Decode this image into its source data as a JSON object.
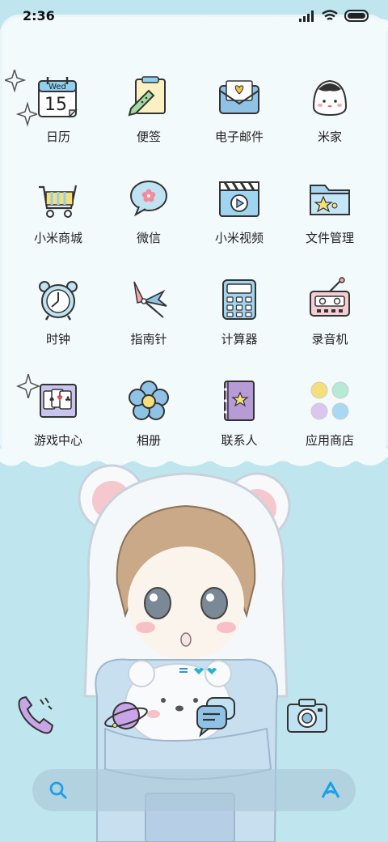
{
  "status": {
    "time": "2:36"
  },
  "apps": [
    {
      "label": "日历",
      "icon": "calendar-icon",
      "day": "Wed",
      "date": "15"
    },
    {
      "label": "便签",
      "icon": "notes-icon"
    },
    {
      "label": "电子邮件",
      "icon": "email-icon"
    },
    {
      "label": "米家",
      "icon": "mijia-icon"
    },
    {
      "label": "小米商城",
      "icon": "shopping-cart-icon"
    },
    {
      "label": "微信",
      "icon": "wechat-icon"
    },
    {
      "label": "小米视频",
      "icon": "video-icon"
    },
    {
      "label": "文件管理",
      "icon": "folder-icon"
    },
    {
      "label": "时钟",
      "icon": "clock-icon"
    },
    {
      "label": "指南针",
      "icon": "compass-icon"
    },
    {
      "label": "计算器",
      "icon": "calculator-icon"
    },
    {
      "label": "录音机",
      "icon": "recorder-icon"
    },
    {
      "label": "游戏中心",
      "icon": "game-cards-icon"
    },
    {
      "label": "相册",
      "icon": "flower-gallery-icon"
    },
    {
      "label": "联系人",
      "icon": "contacts-book-icon"
    },
    {
      "label": "应用商店",
      "icon": "app-store-icon"
    }
  ],
  "dock": [
    "phone-icon",
    "browser-planet-icon",
    "messages-icon",
    "camera-icon"
  ],
  "colors": {
    "background": "#bfe6ee",
    "panel": "#f3fafc",
    "accent_blue": "#8fd0ef"
  }
}
